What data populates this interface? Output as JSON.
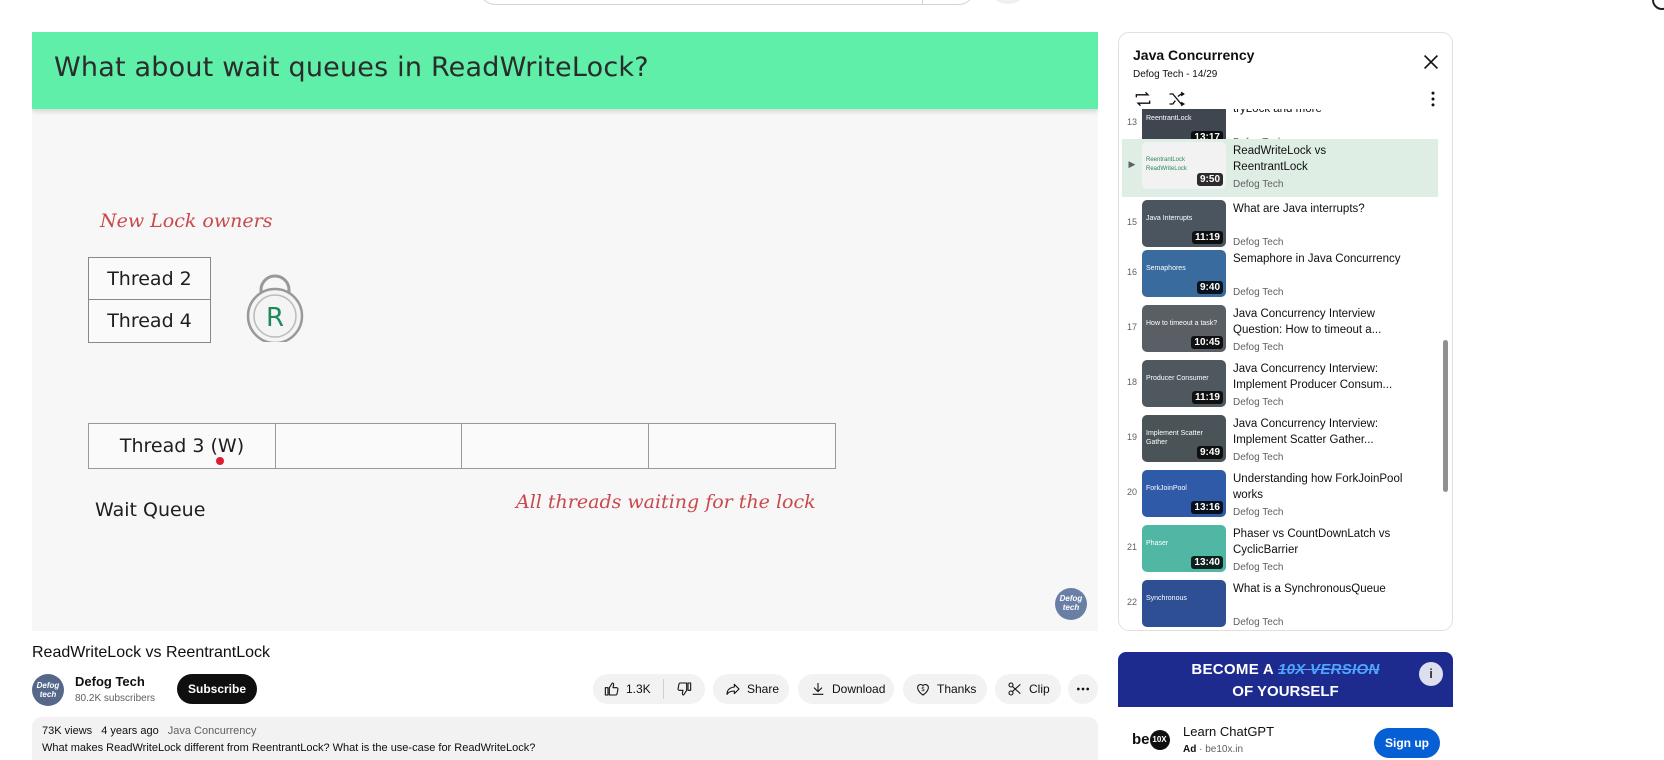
{
  "video": {
    "slide_title": "What about wait queues in ReadWriteLock?",
    "new_lock_owners": "New Lock owners",
    "owners": [
      "Thread 2",
      "Thread 4"
    ],
    "lock_letter": "R",
    "queue_cells": [
      "Thread 3 (W)",
      "",
      "",
      ""
    ],
    "wait_queue_label": "Wait Queue",
    "waiting_note": "All threads waiting for the lock",
    "watermark": "Defog tech"
  },
  "title": "ReadWriteLock vs ReentrantLock",
  "channel": {
    "name": "Defog Tech",
    "subscribers": "80.2K subscribers",
    "avatar_text": "Defog tech",
    "subscribe_label": "Subscribe"
  },
  "actions": {
    "likes": "1.3K",
    "share": "Share",
    "download": "Download",
    "thanks": "Thanks",
    "clip": "Clip"
  },
  "description": {
    "views": "73K views",
    "age": "4 years ago",
    "playlist": "Java Concurrency",
    "text": "What makes ReadWriteLock different from ReentrantLock? What is the use-case for ReadWriteLock?"
  },
  "playlist": {
    "title": "Java Concurrency",
    "subtitle": "Defog Tech - 14/29",
    "items": [
      {
        "index": "13",
        "title": "tryLock and more",
        "channel": "Defog Tech",
        "duration": "13:17",
        "thumb_text": "ReentrantLock",
        "color": "#3f4650"
      },
      {
        "index": "▶",
        "title": "ReadWriteLock vs ReentrantLock",
        "channel": "Defog Tech",
        "duration": "9:50",
        "thumb_text": "ReentrantLock  ReadWriteLock",
        "color": "#f2f2f2",
        "active": true
      },
      {
        "index": "15",
        "title": "What are Java interrupts?",
        "channel": "Defog Tech",
        "duration": "11:19",
        "thumb_text": "Java Interrupts",
        "color": "#4b5560"
      },
      {
        "index": "16",
        "title": "Semaphore in Java Concurrency",
        "channel": "Defog Tech",
        "duration": "9:40",
        "thumb_text": "Semaphores",
        "color": "#3a6b9e"
      },
      {
        "index": "17",
        "title": "Java Concurrency Interview Question: How to timeout a...",
        "channel": "Defog Tech",
        "duration": "10:45",
        "thumb_text": "How to timeout a task?",
        "color": "#5a5f66"
      },
      {
        "index": "18",
        "title": "Java Concurrency Interview: Implement Producer Consum...",
        "channel": "Defog Tech",
        "duration": "11:19",
        "thumb_text": "Producer Consumer",
        "color": "#50585f"
      },
      {
        "index": "19",
        "title": "Java Concurrency Interview: Implement Scatter Gather...",
        "channel": "Defog Tech",
        "duration": "9:49",
        "thumb_text": "Implement Scatter Gather",
        "color": "#4a5358"
      },
      {
        "index": "20",
        "title": "Understanding how ForkJoinPool works",
        "channel": "Defog Tech",
        "duration": "13:16",
        "thumb_text": "ForkJoinPool",
        "color": "#2e5aa8"
      },
      {
        "index": "21",
        "title": "Phaser vs CountDownLatch vs CyclicBarrier",
        "channel": "Defog Tech",
        "duration": "13:40",
        "thumb_text": "Phaser",
        "color": "#4fb7a4"
      },
      {
        "index": "22",
        "title": "What is a SynchronousQueue",
        "channel": "Defog Tech",
        "duration": "",
        "thumb_text": "Synchronous",
        "color": "#2f4f95"
      }
    ]
  },
  "ad": {
    "headline_pre": "BECOME A ",
    "headline_accent": "10X VERSION",
    "headline_line2": "OF YOURSELF",
    "logo": "be",
    "logo_badge": "10X",
    "name": "Learn ChatGPT",
    "ad_label": "Ad",
    "domain": " · be10x.in",
    "cta": "Sign up"
  }
}
